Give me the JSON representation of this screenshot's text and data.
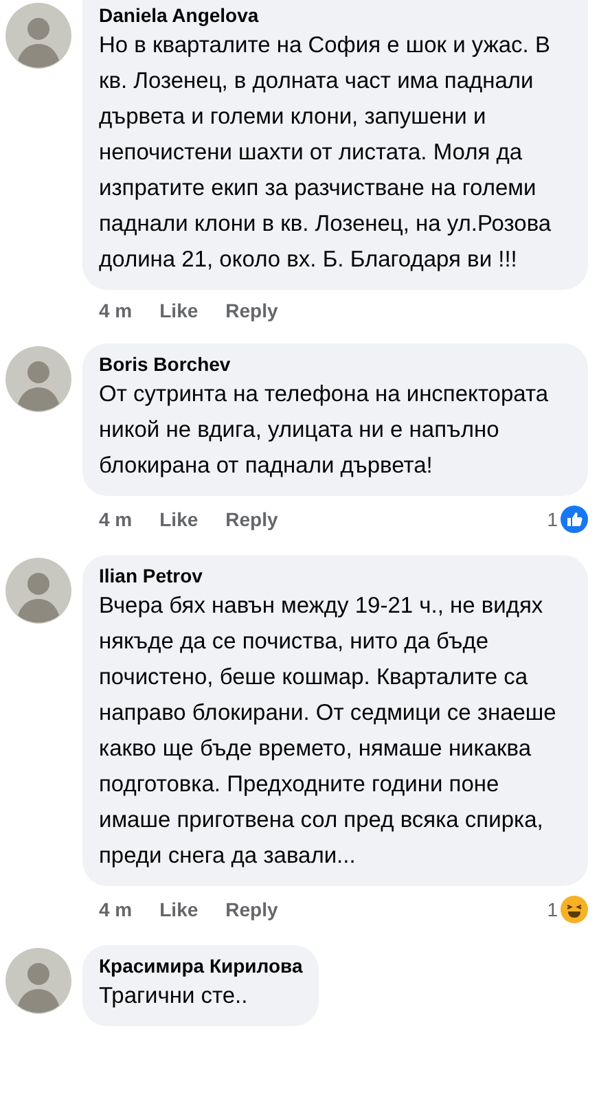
{
  "comments": [
    {
      "author": "Daniela Angelova",
      "text": "Но в кварталите на София е шок и ужас.  В кв. Лозенец,  в долната част има паднали дървета и големи клони, запушени и непочистени шахти от листата. Моля да изпратите екип за разчистване на големи паднали клони в кв. Лозенец,  на ул.Розова долина 21, около вх. Б. Благодаря ви  !!!",
      "time": "4 m",
      "like": "Like",
      "reply": "Reply"
    },
    {
      "author": "Boris Borchev",
      "text": "От сутринта на телефона на инспектората никой не вдига, улицата ни е напълно блокирана от паднали дървета!",
      "time": "4 m",
      "like": "Like",
      "reply": "Reply",
      "reaction": {
        "count": "1",
        "kind": "like"
      }
    },
    {
      "author": "Ilian Petrov",
      "text": "Вчера бях навън между 19-21 ч., не видях някъде да се почиства, нито да бъде почистено, беше кошмар. Кварталите са направо блокирани. От седмици се знаеше какво ще бъде времето, нямаше никаква подготовка. Предходните години поне имаше приготвена сол пред всяка спирка, преди снега да завали...",
      "time": "4 m",
      "like": "Like",
      "reply": "Reply",
      "reaction": {
        "count": "1",
        "kind": "haha"
      }
    },
    {
      "author": "Красимира Кирилова",
      "text": "Трагични сте.."
    }
  ]
}
